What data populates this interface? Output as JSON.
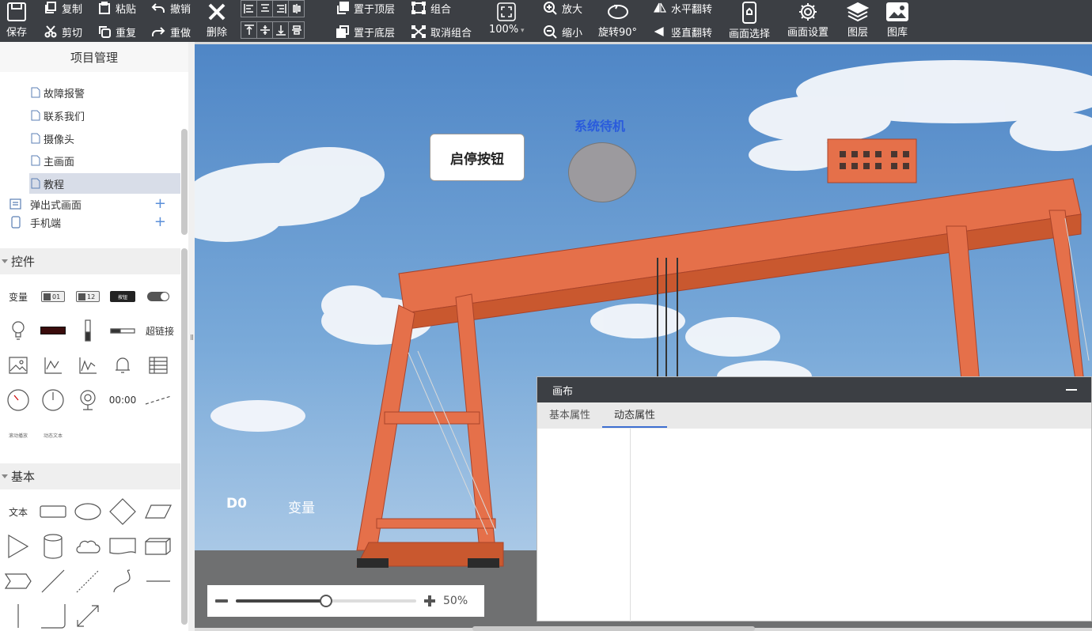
{
  "toolbar": {
    "save": "保存",
    "copy": "复制",
    "paste": "粘贴",
    "undo": "撤销",
    "cut": "剪切",
    "redo_repeat": "重复",
    "redo": "重做",
    "delete": "删除",
    "bring_top": "置于顶层",
    "send_bottom": "置于底层",
    "group": "组合",
    "ungroup": "取消组合",
    "zoom_level": "100%",
    "zoom_in": "放大",
    "zoom_out": "缩小",
    "rotate": "旋转90°",
    "flip_h": "水平翻转",
    "flip_v": "竖直翻转",
    "screen_select": "画面选择",
    "screen_settings": "画面设置",
    "layers": "图层",
    "gallery": "图库"
  },
  "sidebar": {
    "title": "项目管理",
    "pages": [
      {
        "label": "故障报警"
      },
      {
        "label": "联系我们"
      },
      {
        "label": "摄像头"
      },
      {
        "label": "主画面"
      },
      {
        "label": "教程",
        "selected": true
      }
    ],
    "roots": [
      {
        "label": "弹出式画面",
        "icon": "popup-screen-icon"
      },
      {
        "label": "手机端",
        "icon": "mobile-icon"
      }
    ],
    "controls_title": "控件",
    "controls": {
      "variable": "变量",
      "num01": "01",
      "num12": "12",
      "btn_text": "按钮",
      "hyperlink": "超链接",
      "time": "00:00",
      "scroll_text": "滚动播放",
      "dynamic_text": "动态文本"
    },
    "basic_title": "基本",
    "basic": {
      "text": "文本"
    }
  },
  "canvas": {
    "start_button": "启停按钮",
    "status_label": "系统待机",
    "d0": "D0",
    "variable": "变量"
  },
  "zoom": {
    "value": "50%",
    "slider_level": 0.5
  },
  "panel": {
    "title": "画布",
    "tabs": [
      "基本属性",
      "动态属性"
    ],
    "active_tab": "动态属性"
  },
  "colors": {
    "toolbar_bg": "#3c3f44",
    "accent": "#3d6fd1",
    "status_label": "#2a5bdc",
    "selected_row": "#d8dde8"
  }
}
